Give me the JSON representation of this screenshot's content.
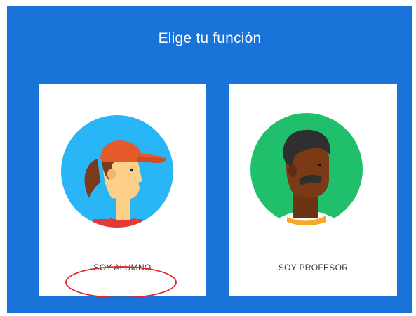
{
  "header": {
    "title": "Elige tu función"
  },
  "roles": [
    {
      "label": "SOY ALUMNO",
      "avatar": "student-avatar-icon",
      "circle_color": "#29b6f6"
    },
    {
      "label": "SOY PROFESOR",
      "avatar": "teacher-avatar-icon",
      "circle_color": "#1fbf6b"
    }
  ],
  "colors": {
    "background": "#1a73d9",
    "card": "#ffffff",
    "annotation": "#e3262a"
  }
}
